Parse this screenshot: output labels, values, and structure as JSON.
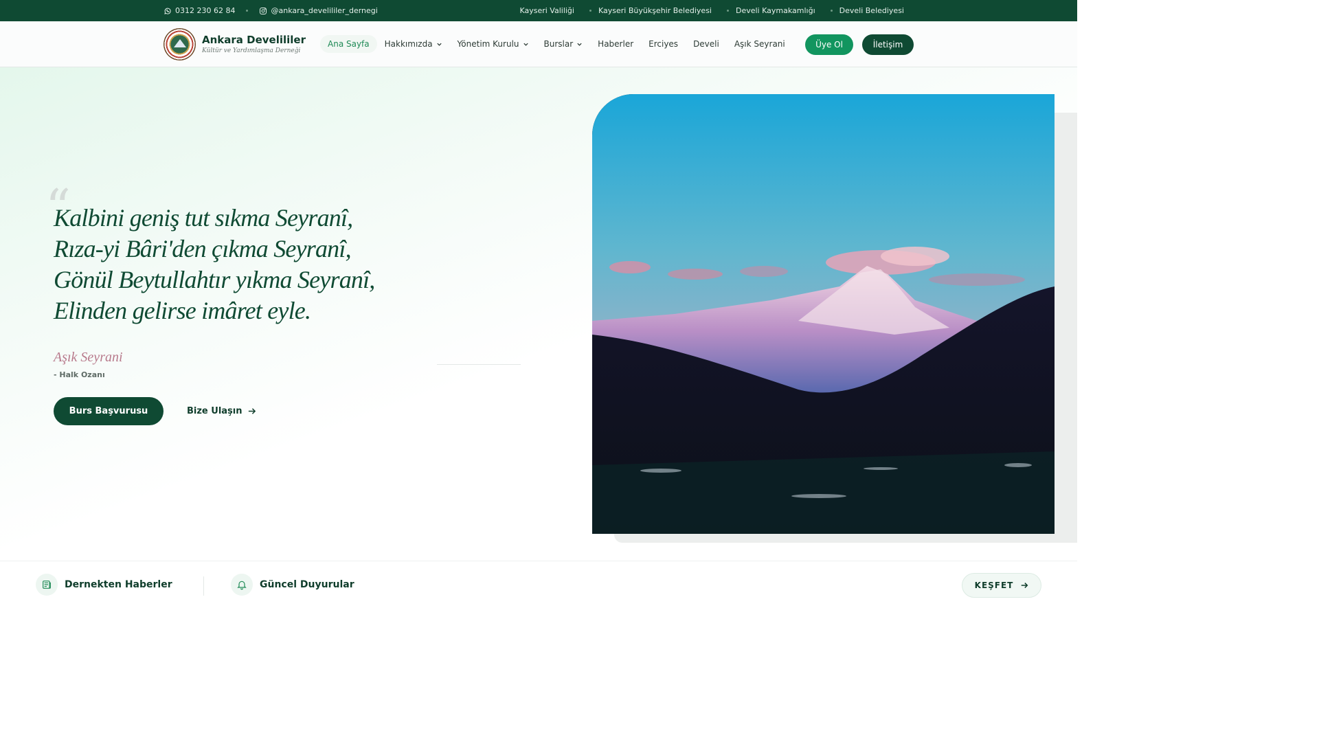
{
  "topbar": {
    "phone": "0312 230 62 84",
    "instagram": "@ankara_develililer_dernegi",
    "links": [
      "Kayseri Valiliği",
      "Kayseri Büyükşehir Belediyesi",
      "Develi Kaymakamlığı",
      "Develi Belediyesi"
    ]
  },
  "brand": {
    "name": "Ankara Develililer",
    "tagline": "Kültür ve Yardımlaşma Derneği"
  },
  "nav": {
    "items": [
      "Ana Sayfa",
      "Hakkımızda",
      "Yönetim Kurulu",
      "Burslar",
      "Haberler",
      "Erciyes",
      "Develi",
      "Aşık Seyrani"
    ],
    "active": "Ana Sayfa",
    "dropdown_items": [
      "Hakkımızda",
      "Yönetim Kurulu",
      "Burslar"
    ]
  },
  "header_buttons": {
    "join": "Üye Ol",
    "contact": "İletişim"
  },
  "hero": {
    "quote_mark": "“",
    "poem": [
      "Kalbini geniş tut sıkma Seyranî,",
      "Rıza-yi Bâri'den çıkma Seyranî,",
      "Gönül Beytullahtır yıkma Seyranî,",
      "Elinden gelirse imâret eyle."
    ],
    "author": "Aşık Seyrani",
    "author_title": "- Halk Ozanı",
    "primary_button": "Burs Başvurusu",
    "secondary_button": "Bize Ulaşın",
    "image_icon": "mountain-photo"
  },
  "strip": {
    "news": "Dernekten Haberler",
    "announcements": "Güncel Duyurular",
    "explore": "KEŞFET"
  },
  "colors": {
    "primary_dark": "#0f4a33",
    "primary_green": "#12955f",
    "author_pink": "#b87a8c"
  }
}
